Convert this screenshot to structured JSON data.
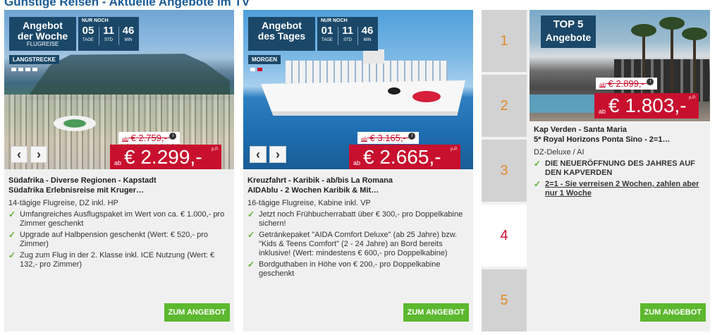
{
  "page_title": "Günstige Reisen - Aktuelle Angebote im TV",
  "card1": {
    "badge": {
      "line1": "Angebot",
      "line2": "der Woche",
      "line3": "FLUGREISE"
    },
    "countdown": {
      "title": "NUR NOCH",
      "days": "05",
      "days_label": "TAGE",
      "hours": "11",
      "hours_label": "STD",
      "minutes": "46",
      "minutes_label": "MIN"
    },
    "category": "LANGSTRECKE",
    "prev_label": "‹",
    "next_label": "›",
    "old_price_prefix": "ab",
    "old_price": "€ 2.759,-",
    "new_price_prefix": "ab",
    "new_price": "€ 2.299,-",
    "per_person": "p.P.",
    "title_line1": "Südafrika - Diverse Regionen - Kapstadt",
    "title_line2": "Südafrika Erlebnisreise mit Kruger…",
    "subtitle": "14-tägige Flugreise, DZ inkl. HP",
    "features": [
      "Umfangreiches Ausflugspaket im Wert von ca. € 1.000,- pro Zimmer geschenkt",
      "Upgrade auf Halbpension geschenkt (Wert: € 520,- pro Zimmer)",
      "Zug zum Flug in der 2. Klasse inkl. ICE Nutzung (Wert: € 132,- pro Zimmer)"
    ],
    "cta": "ZUM ANGEBOT"
  },
  "card2": {
    "badge": {
      "line1": "Angebot",
      "line2": "des Tages"
    },
    "countdown": {
      "title": "NUR NOCH",
      "days": "01",
      "days_label": "TAGE",
      "hours": "11",
      "hours_label": "STD",
      "minutes": "46",
      "minutes_label": "MIN"
    },
    "category": "MORGEN",
    "prev_label": "‹",
    "next_label": "›",
    "old_price_prefix": "ab",
    "old_price": "€ 3.165,-",
    "new_price_prefix": "ab",
    "new_price": "€ 2.665,-",
    "per_person": "p.P.",
    "title_line1": "Kreuzfahrt - Karibik - ab/bis La Romana",
    "title_line2": "AIDAblu - 2 Wochen Karibik & Mit…",
    "subtitle": "16-tägige Flugreise, Kabine inkl. VP",
    "features": [
      "Jetzt noch Frühbucherrabatt über € 300,- pro Doppelkabine sichern!",
      "Getränkepaket \"AIDA Comfort Deluxe\" (ab 25 Jahre) bzw. \"Kids & Teens Comfort\" (2 - 24 Jahre) an Bord bereits inklusive! (Wert: mindestens € 600,- pro Doppelkabine)",
      "Bordguthaben in Höhe von € 200,- pro Doppelkabine geschenkt"
    ],
    "cta": "ZUM ANGEBOT"
  },
  "card3": {
    "tabs": [
      "1",
      "2",
      "3",
      "4",
      "5"
    ],
    "active_tab": "4",
    "badge": {
      "line1": "TOP 5",
      "line2": "Angebote"
    },
    "old_price_prefix": "ab",
    "old_price": "€ 2.899,-",
    "new_price_prefix": "ab",
    "new_price": "€ 1.803,-",
    "per_person": "p.P.",
    "title_line1": "Kap Verden - Santa Maria",
    "title_line2": "5* Royal Horizons Ponta Sino - 2=1…",
    "subtitle": "DZ-Deluxe / AI",
    "features": [
      "DIE NEUERÖFFNUNG DES JAHRES AUF DEN KAPVERDEN",
      "2=1 - Sie verreisen 2 Wochen, zahlen aber nur 1 Woche"
    ],
    "cta": "ZUM ANGEBOT"
  },
  "colors": {
    "brand_blue": "#1b4869",
    "price_red": "#c8102e",
    "cta_green": "#5cb82e",
    "check_green": "#5db12f",
    "tab_orange": "#e08a28"
  }
}
